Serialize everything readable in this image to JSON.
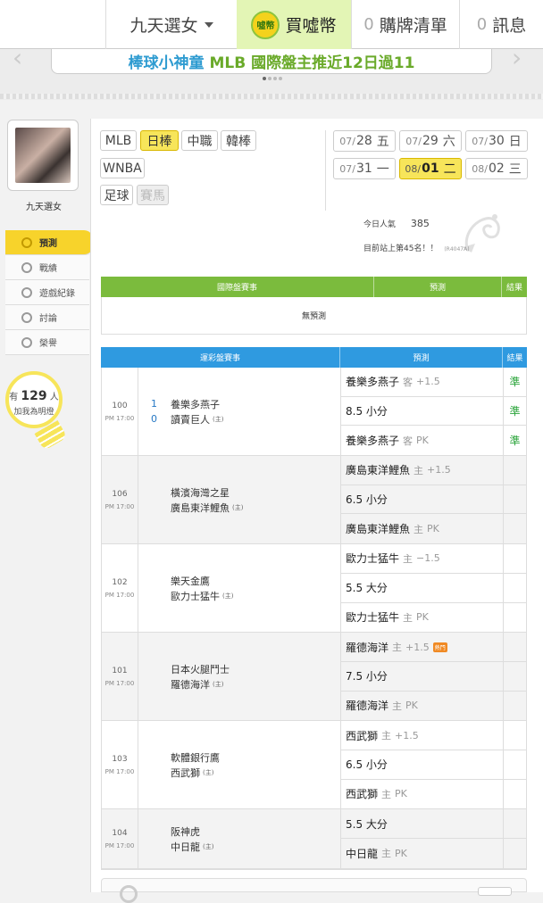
{
  "nav": {
    "user_name": "九天選女",
    "coin_icon_text": "噓幣",
    "buy_coin": "買噓幣",
    "buy_list_count": "0",
    "buy_list": "購牌清單",
    "message_count": "0",
    "messages": "訊息"
  },
  "banner": {
    "text_main": "棒球小神童",
    "text_highlight": "MLB 國際盤主推近12日過11"
  },
  "profile": {
    "name": "九天選女",
    "fans_prefix": "有",
    "fans_count": "129",
    "fans_suffix": "人",
    "fans_note": "加我為明燈"
  },
  "side_menu": [
    {
      "label": "預測",
      "icon": "target-icon",
      "active": true
    },
    {
      "label": "戰績",
      "icon": "chart-icon"
    },
    {
      "label": "遊戲紀錄",
      "icon": "record-icon"
    },
    {
      "label": "討論",
      "icon": "chat-icon"
    },
    {
      "label": "榮譽",
      "icon": "medal-icon"
    }
  ],
  "leagues": [
    "MLB",
    "日棒",
    "中職",
    "韓棒",
    "WNBA",
    "足球",
    "賽馬"
  ],
  "selected_league": "日棒",
  "dates": [
    {
      "md": "07/",
      "d": "28",
      "wd": "五"
    },
    {
      "md": "07/",
      "d": "29",
      "wd": "六"
    },
    {
      "md": "07/",
      "d": "30",
      "wd": "日"
    },
    {
      "md": "07/",
      "d": "31",
      "wd": "一"
    },
    {
      "md": "08/",
      "d": "01",
      "wd": "二"
    },
    {
      "md": "08/",
      "d": "02",
      "wd": "三"
    }
  ],
  "stats": {
    "popularity_label": "今日人氣",
    "popularity_value": "385",
    "rank_text": "目前站上第45名！！",
    "rank_code": "(R4047A)"
  },
  "intl": {
    "col_event": "國際盤賽事",
    "col_pred": "預測",
    "col_result": "結果",
    "empty": "無預測"
  },
  "lottery": {
    "col_event": "運彩盤賽事",
    "col_pred": "預測",
    "col_result": "結果",
    "home_mark": "(主)",
    "side_away": "客",
    "side_home": "主",
    "hot_tag": "熱門",
    "games": [
      {
        "code": "100",
        "time": "PM 17:00",
        "away": "養樂多燕子",
        "home": "讀賣巨人",
        "away_score": "1",
        "home_score": "0",
        "preds": [
          {
            "team": "養樂多燕子",
            "side": "客",
            "line": "+1.5",
            "result": "準"
          },
          {
            "team": "8.5 小分",
            "side": "",
            "line": "",
            "result": "準"
          },
          {
            "team": "養樂多燕子",
            "side": "客",
            "line": "PK",
            "result": "準"
          }
        ]
      },
      {
        "code": "106",
        "time": "PM 17:00",
        "away": "橫濱海灣之星",
        "home": "廣島東洋鯉魚",
        "away_score": "",
        "home_score": "",
        "preds": [
          {
            "team": "廣島東洋鯉魚",
            "side": "主",
            "line": "+1.5",
            "result": ""
          },
          {
            "team": "6.5 小分",
            "side": "",
            "line": "",
            "result": ""
          },
          {
            "team": "廣島東洋鯉魚",
            "side": "主",
            "line": "PK",
            "result": ""
          }
        ]
      },
      {
        "code": "102",
        "time": "PM 17:00",
        "away": "樂天金鷹",
        "home": "歐力士猛牛",
        "away_score": "",
        "home_score": "",
        "preds": [
          {
            "team": "歐力士猛牛",
            "side": "主",
            "line": "−1.5",
            "result": ""
          },
          {
            "team": "5.5 大分",
            "side": "",
            "line": "",
            "result": ""
          },
          {
            "team": "歐力士猛牛",
            "side": "主",
            "line": "PK",
            "result": ""
          }
        ]
      },
      {
        "code": "101",
        "time": "PM 17:00",
        "away": "日本火腿鬥士",
        "home": "羅德海洋",
        "away_score": "",
        "home_score": "",
        "preds": [
          {
            "team": "羅德海洋",
            "side": "主",
            "line": "+1.5",
            "result": "",
            "hot": true
          },
          {
            "team": "7.5 小分",
            "side": "",
            "line": "",
            "result": ""
          },
          {
            "team": "羅德海洋",
            "side": "主",
            "line": "PK",
            "result": ""
          }
        ]
      },
      {
        "code": "103",
        "time": "PM 17:00",
        "away": "軟體銀行鷹",
        "home": "西武獅",
        "away_score": "",
        "home_score": "",
        "preds": [
          {
            "team": "西武獅",
            "side": "主",
            "line": "+1.5",
            "result": ""
          },
          {
            "team": "6.5 小分",
            "side": "",
            "line": "",
            "result": ""
          },
          {
            "team": "西武獅",
            "side": "主",
            "line": "PK",
            "result": ""
          }
        ]
      },
      {
        "code": "104",
        "time": "PM 17:00",
        "away": "阪神虎",
        "home": "中日龍",
        "away_score": "",
        "home_score": "",
        "preds": [
          {
            "team": "5.5 大分",
            "side": "",
            "line": "",
            "result": ""
          },
          {
            "team": "中日龍",
            "side": "主",
            "line": "PK",
            "result": ""
          }
        ]
      }
    ]
  }
}
